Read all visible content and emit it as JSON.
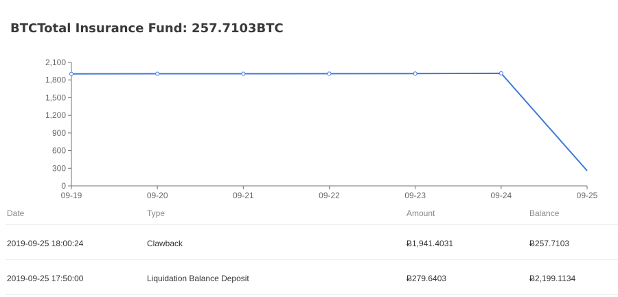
{
  "header": {
    "title": "BTCTotal Insurance Fund: 257.7103BTC"
  },
  "chart_data": {
    "type": "line",
    "title": "",
    "xlabel": "",
    "ylabel": "",
    "categories": [
      "09-19",
      "09-20",
      "09-21",
      "09-22",
      "09-23",
      "09-24",
      "09-25"
    ],
    "values": [
      1905,
      1907,
      1908,
      1909,
      1910,
      1915,
      258
    ],
    "y_ticks": [
      "0",
      "300",
      "600",
      "900",
      "1,200",
      "1,500",
      "1,800",
      "2,100"
    ],
    "y_tick_values": [
      0,
      300,
      600,
      900,
      1200,
      1500,
      1800,
      2100
    ],
    "ylim": [
      0,
      2100
    ],
    "grid": false,
    "line_color": "#3c78d8"
  },
  "table": {
    "columns": {
      "date": "Date",
      "type": "Type",
      "amount": "Amount",
      "balance": "Balance"
    },
    "rows": [
      {
        "date": "2019-09-25 18:00:24",
        "type": "Clawback",
        "amount": "Ƀ1,941.4031",
        "balance": "Ƀ257.7103"
      },
      {
        "date": "2019-09-25 17:50:00",
        "type": "Liquidation Balance Deposit",
        "amount": "Ƀ279.6403",
        "balance": "Ƀ2,199.1134"
      }
    ]
  }
}
